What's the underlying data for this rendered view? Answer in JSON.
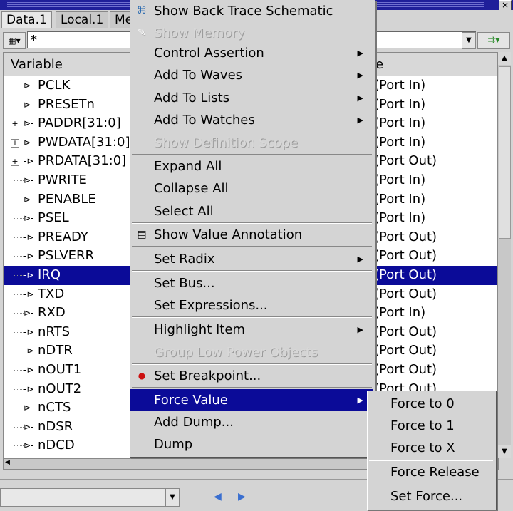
{
  "window": {
    "close_glyph": "×"
  },
  "tabs": [
    "Data.1",
    "Local.1",
    "Me"
  ],
  "filter": {
    "value": "*"
  },
  "table": {
    "col_variable": "Variable",
    "col_kind": "e",
    "rows": [
      {
        "name": "PCLK",
        "kind": "(Port In)",
        "expandable": false
      },
      {
        "name": "PRESETn",
        "kind": "(Port In)",
        "expandable": false
      },
      {
        "name": "PADDR[31:0]",
        "kind": "(Port In)",
        "expandable": true
      },
      {
        "name": "PWDATA[31:0]",
        "kind": "(Port In)",
        "expandable": true
      },
      {
        "name": "PRDATA[31:0]",
        "kind": "(Port Out)",
        "expandable": true
      },
      {
        "name": "PWRITE",
        "kind": "(Port In)",
        "expandable": false
      },
      {
        "name": "PENABLE",
        "kind": "(Port In)",
        "expandable": false
      },
      {
        "name": "PSEL",
        "kind": "(Port In)",
        "expandable": false
      },
      {
        "name": "PREADY",
        "kind": "(Port Out)",
        "expandable": false
      },
      {
        "name": "PSLVERR",
        "kind": "(Port Out)",
        "expandable": false
      },
      {
        "name": "IRQ",
        "kind": "(Port Out)",
        "expandable": false,
        "selected": true
      },
      {
        "name": "TXD",
        "kind": "(Port Out)",
        "expandable": false
      },
      {
        "name": "RXD",
        "kind": "(Port In)",
        "expandable": false
      },
      {
        "name": "nRTS",
        "kind": "(Port Out)",
        "expandable": false
      },
      {
        "name": "nDTR",
        "kind": "(Port Out)",
        "expandable": false
      },
      {
        "name": "nOUT1",
        "kind": "(Port Out)",
        "expandable": false
      },
      {
        "name": "nOUT2",
        "kind": "(Port Out)",
        "expandable": false
      },
      {
        "name": "nCTS",
        "kind": "",
        "expandable": false
      },
      {
        "name": "nDSR",
        "kind": "",
        "expandable": false
      },
      {
        "name": "nDCD",
        "kind": "",
        "expandable": false
      }
    ]
  },
  "menu": {
    "items": [
      {
        "label": "Show Back Trace Schematic",
        "icon": "schematic-icon",
        "enabled": true
      },
      {
        "label": "Show Memory",
        "icon": "memory-icon",
        "enabled": false
      },
      {
        "label": "Control Assertion",
        "submenu": true,
        "enabled": true
      },
      {
        "label": "Add To Waves",
        "submenu": true,
        "enabled": true
      },
      {
        "label": "Add To Lists",
        "submenu": true,
        "enabled": true
      },
      {
        "label": "Add To Watches",
        "submenu": true,
        "enabled": true
      },
      {
        "label": "Show Definition Scope",
        "enabled": false
      },
      {
        "label": "Expand All",
        "enabled": true
      },
      {
        "label": "Collapse All",
        "enabled": true
      },
      {
        "label": "Select All",
        "enabled": true
      },
      {
        "label": "Show Value Annotation",
        "icon": "annotation-icon",
        "enabled": true
      },
      {
        "label": "Set Radix",
        "submenu": true,
        "enabled": true
      },
      {
        "label": "Set Bus...",
        "enabled": true
      },
      {
        "label": "Set Expressions...",
        "enabled": true
      },
      {
        "label": "Highlight Item",
        "submenu": true,
        "enabled": true
      },
      {
        "label": "Group Low Power Objects",
        "enabled": false
      },
      {
        "label": "Set Breakpoint...",
        "icon": "breakpoint-icon",
        "enabled": true
      },
      {
        "label": "Force Value",
        "submenu": true,
        "enabled": true,
        "highlighted": true
      },
      {
        "label": "Add Dump...",
        "enabled": true
      },
      {
        "label": "Dump",
        "enabled": true
      }
    ]
  },
  "submenu": {
    "items": [
      "Force to 0",
      "Force to 1",
      "Force to X",
      "Force Release",
      "Set Force..."
    ]
  },
  "colors": {
    "selection": "#0b0b98",
    "breakpoint": "#cc1111"
  }
}
